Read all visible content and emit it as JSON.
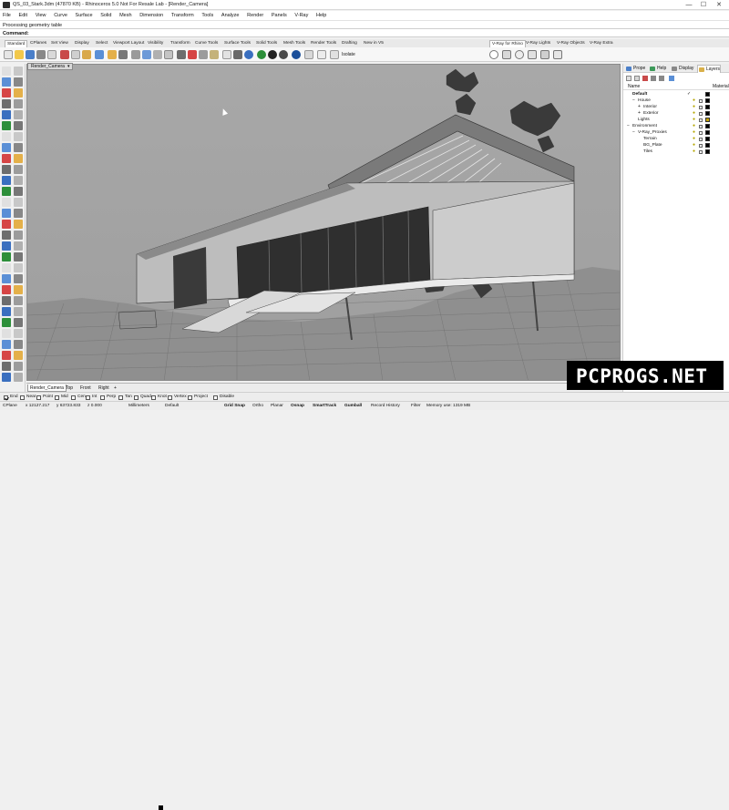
{
  "window": {
    "title": "QS_03_Stark.3dm (47870 KB) - Rhinoceros 5.0 Not For Resale Lab - [Render_Camera]",
    "minimize": "—",
    "maximize": "☐",
    "close": "✕"
  },
  "menu": [
    "File",
    "Edit",
    "View",
    "Curve",
    "Surface",
    "Solid",
    "Mesh",
    "Dimension",
    "Transform",
    "Tools",
    "Analyze",
    "Render",
    "Panels",
    "V-Ray",
    "Help"
  ],
  "command": {
    "history": "Processing geometry table",
    "prompt": "Command:"
  },
  "toolbar_tabs": [
    "Standard",
    "CPlanes",
    "Set View",
    "Display",
    "Select",
    "Viewport Layout",
    "Visibility",
    "Transform",
    "Curve Tools",
    "Surface Tools",
    "Solid Tools",
    "Mesh Tools",
    "Render Tools",
    "Drafting",
    "New in V5"
  ],
  "vray_tabs": [
    "V-Ray for Rhino",
    "V-Ray Lights",
    "V-Ray Objects",
    "V-Ray Extra"
  ],
  "toolbar_extra": "Isolate",
  "viewport": {
    "name": "Render_Camera",
    "tabs": [
      "Render_Camera",
      "Top",
      "Front",
      "Right"
    ],
    "add_tab": "+"
  },
  "panel": {
    "tabs": [
      "Prope",
      "Help",
      "Display",
      "Layers"
    ],
    "columns": {
      "name": "Name",
      "material": "Material"
    },
    "layers": [
      {
        "name": "Default",
        "bold": true,
        "indent": 0,
        "check": "✓",
        "color": "#000000"
      },
      {
        "name": "House",
        "indent": 1,
        "expander": "−",
        "color": "#000000"
      },
      {
        "name": "Interior",
        "indent": 2,
        "expander": "+",
        "color": "#000000"
      },
      {
        "name": "Exterior",
        "indent": 2,
        "expander": "+",
        "color": "#000000"
      },
      {
        "name": "Lights",
        "indent": 1,
        "color": "#c8a400"
      },
      {
        "name": "Environment",
        "indent": 0,
        "expander": "−",
        "color": "#000000"
      },
      {
        "name": "V-Ray_Proxies",
        "indent": 1,
        "expander": "−",
        "color": "#000000"
      },
      {
        "name": "Terrain",
        "indent": 2,
        "color": "#000000"
      },
      {
        "name": "BG_Plate",
        "indent": 2,
        "color": "#000000"
      },
      {
        "name": "Tiles",
        "indent": 2,
        "color": "#000000"
      }
    ]
  },
  "osnaps": [
    {
      "label": "End",
      "on": true
    },
    {
      "label": "Near",
      "on": false
    },
    {
      "label": "Point",
      "on": false
    },
    {
      "label": "Mid",
      "on": false
    },
    {
      "label": "Cen",
      "on": false
    },
    {
      "label": "Int",
      "on": false
    },
    {
      "label": "Perp",
      "on": false
    },
    {
      "label": "Tan",
      "on": false
    },
    {
      "label": "Quad",
      "on": false
    },
    {
      "label": "Knot",
      "on": false
    },
    {
      "label": "Vertex",
      "on": false
    },
    {
      "label": "Project",
      "on": false
    },
    {
      "label": "Disable",
      "on": false
    }
  ],
  "status": {
    "cplane": "CPlane",
    "x": "x 12127.217",
    "y": "y 63723.833",
    "z": "z 0.000",
    "units": "Millimeters",
    "layer": "Default",
    "grid_snap": "Grid Snap",
    "ortho": "Ortho",
    "planar": "Planar",
    "osnap": "Osnap",
    "smarttrack": "SmartTrack",
    "gumball": "Gumball",
    "record_history": "Record History",
    "filter": "Filter",
    "memory": "Memory use: 1319 MB"
  },
  "watermark": "PCPROGS.NET",
  "colors": {
    "viewport_bg": "#a6a6a6",
    "active_tab": "#ffffff",
    "accent": "#2b6cc4"
  }
}
